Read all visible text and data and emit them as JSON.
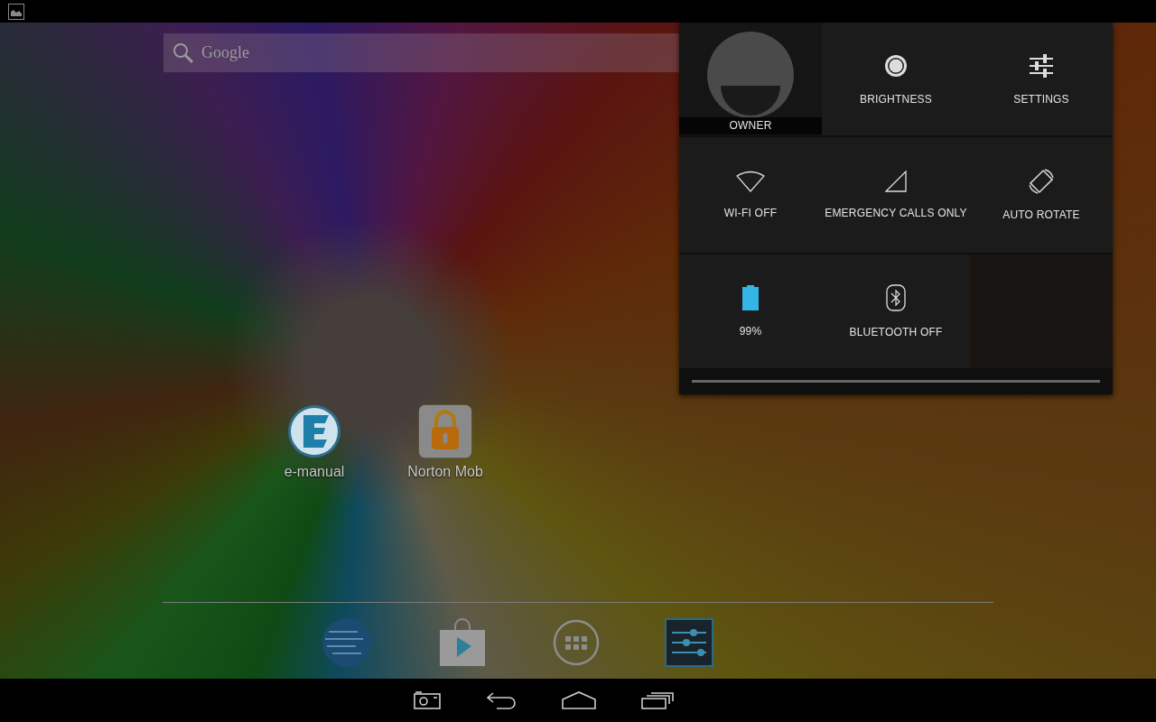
{
  "search": {
    "placeholder": "Google"
  },
  "desktop_shortcuts": [
    {
      "kind": "emanual",
      "label": "e-manual"
    },
    {
      "kind": "lock",
      "label": "Norton Mob"
    }
  ],
  "dock": [
    {
      "kind": "globe"
    },
    {
      "kind": "store"
    },
    {
      "kind": "apps"
    },
    {
      "kind": "settings"
    }
  ],
  "quick_settings": [
    {
      "kind": "user",
      "label": "OWNER"
    },
    {
      "kind": "brightness",
      "label": "BRIGHTNESS"
    },
    {
      "kind": "settings",
      "label": "SETTINGS"
    },
    {
      "kind": "wifi",
      "label": "WI-FI OFF"
    },
    {
      "kind": "signal",
      "label": "EMERGENCY CALLS ONLY"
    },
    {
      "kind": "rotate",
      "label": "AUTO ROTATE"
    },
    {
      "kind": "battery",
      "label": "99%"
    },
    {
      "kind": "bluetooth",
      "label": "BLUETOOTH OFF"
    },
    {
      "kind": "empty"
    }
  ],
  "nav_bar": [
    {
      "kind": "screenshot"
    },
    {
      "kind": "back"
    },
    {
      "kind": "home"
    },
    {
      "kind": "recents"
    }
  ]
}
